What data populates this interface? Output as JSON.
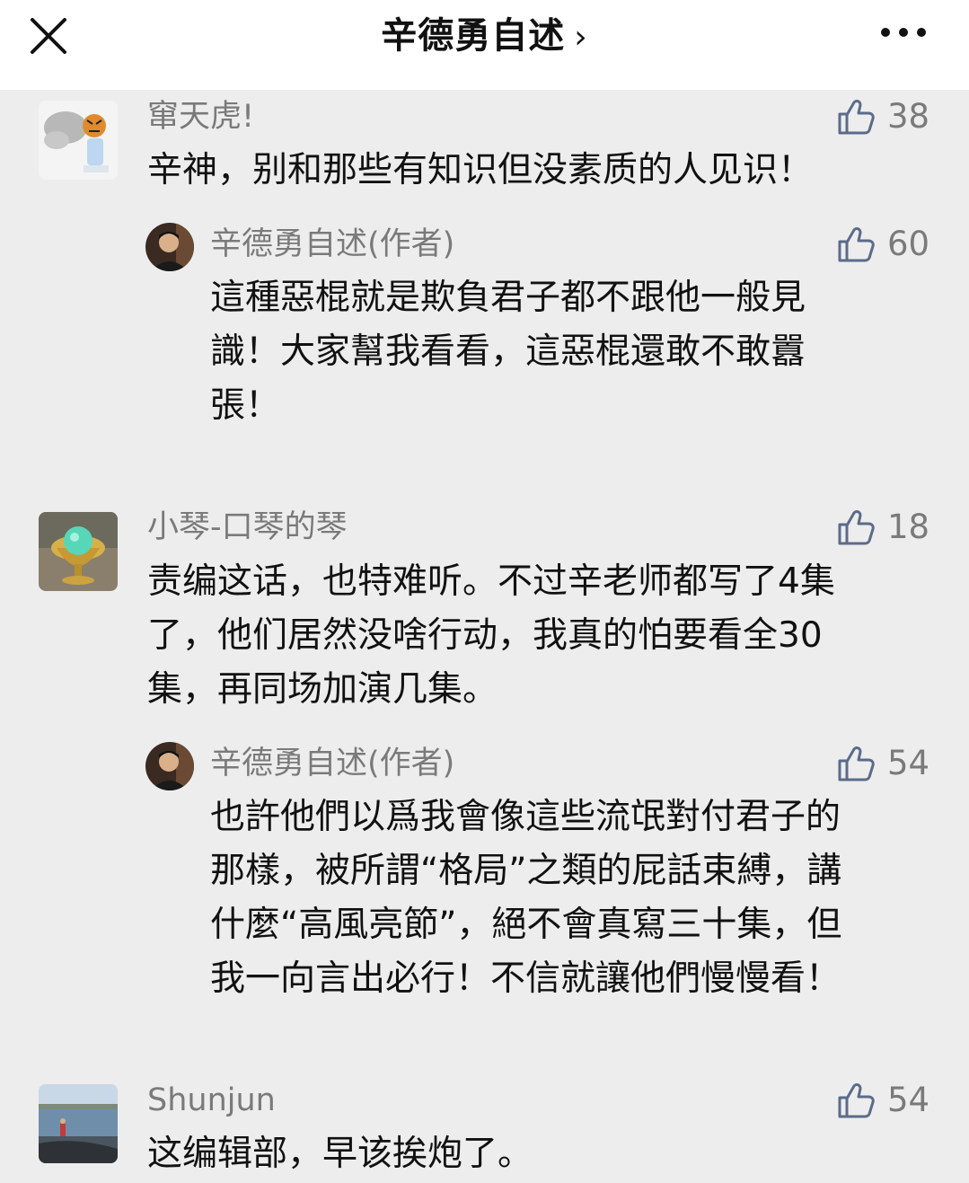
{
  "header": {
    "title": "辛德勇自述",
    "chevron": "›"
  },
  "comments": [
    {
      "name": "窜天虎!",
      "likes": "38",
      "text": "辛神，别和那些有知识但没素质的人见识！",
      "reply": {
        "name": "辛德勇自述(作者)",
        "likes": "60",
        "lines": [
          "這種惡棍就是欺負君子都不跟他一般見",
          "識！大家幫我看看，這惡棍還敢不敢囂",
          "張！"
        ]
      }
    },
    {
      "name": "小琴-口琴的琴",
      "likes": "18",
      "lines": [
        "责编这话，也特难听。不过辛老师都写了4集",
        "了，他们居然没啥行动，我真的怕要看全30",
        "集，再同场加演几集。"
      ],
      "reply": {
        "name": "辛德勇自述(作者)",
        "likes": "54",
        "lines": [
          "也許他們以爲我會像這些流氓對付君子的",
          "那樣，被所謂“格局”之類的屁話束縛，講",
          "什麼“高風亮節”，絕不會真寫三十集，但",
          "我一向言出必行！不信就讓他們慢慢看！"
        ]
      }
    },
    {
      "name": "Shunjun",
      "likes": "54",
      "text": "这编辑部，早该挨炮了。"
    }
  ]
}
